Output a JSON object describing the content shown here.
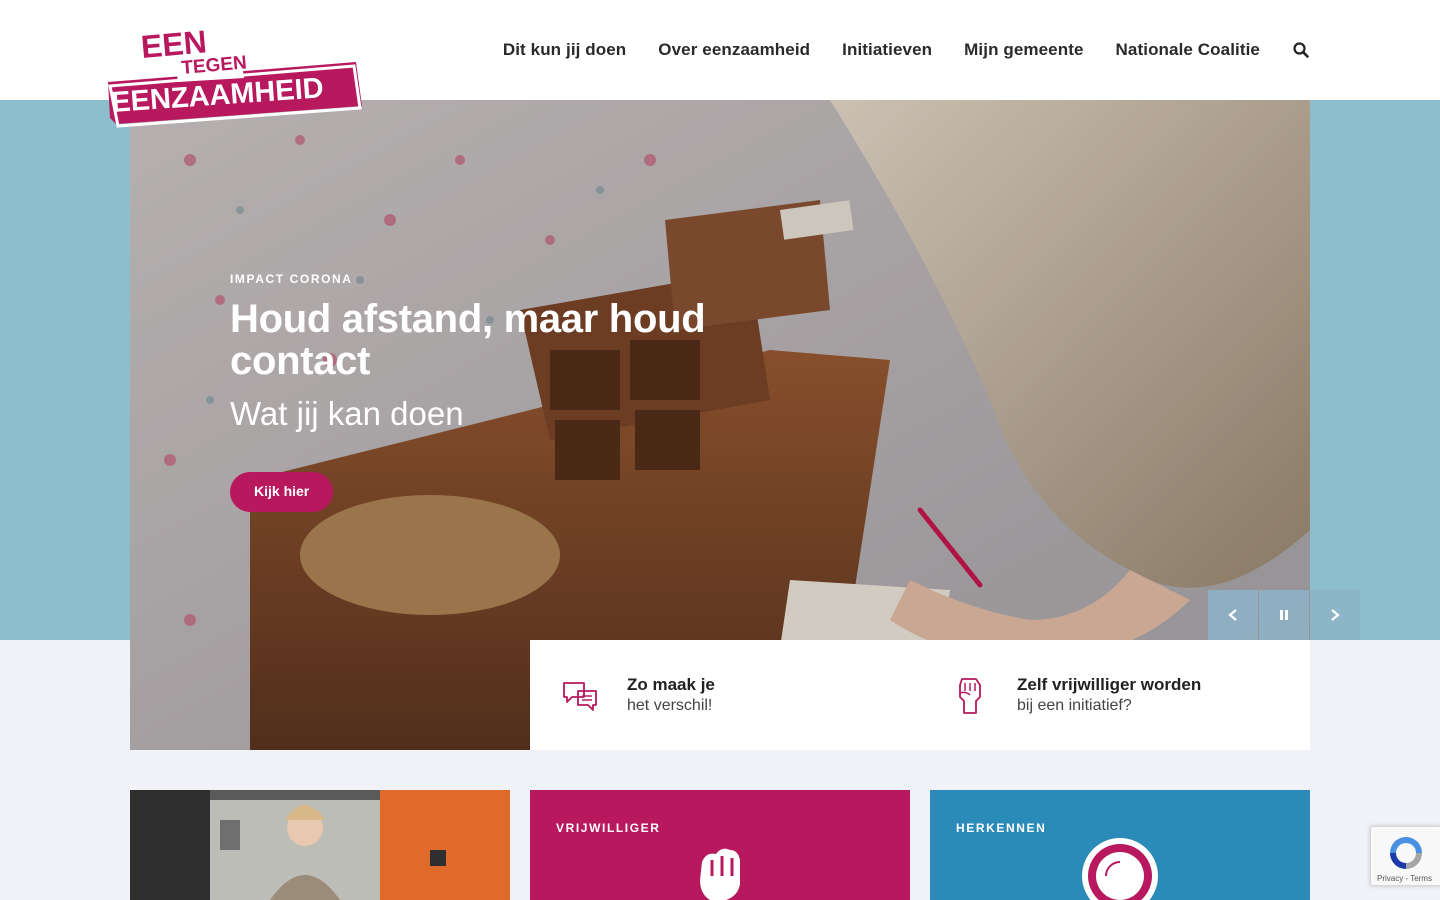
{
  "logo": {
    "line1": "EEN",
    "line2": "TEGEN",
    "line3": "EENZAAMHEID"
  },
  "nav": {
    "items": [
      "Dit kun jij doen",
      "Over eenzaamheid",
      "Initiatieven",
      "Mijn gemeente",
      "Nationale Coalitie"
    ],
    "search_icon": "search-icon"
  },
  "hero": {
    "eyebrow": "IMPACT CORONA",
    "title": "Houd afstand, maar houd contact",
    "subtitle": "Wat jij kan doen",
    "button": "Kijk hier",
    "controls": [
      "prev-icon",
      "pause-icon",
      "next-icon"
    ]
  },
  "features": [
    {
      "title": "Zo maak je",
      "subtitle": "het verschil!",
      "icon": "chat-bubbles-icon"
    },
    {
      "title": "Zelf vrijwilliger worden",
      "subtitle": "bij een initiatief?",
      "icon": "raised-fist-icon"
    }
  ],
  "cards": [
    {
      "label": "",
      "icon": "photo"
    },
    {
      "label": "VRIJWILLIGER",
      "icon": "fist-icon"
    },
    {
      "label": "HERKENNEN",
      "icon": "circle-icon"
    }
  ],
  "recaptcha": {
    "text": "Privacy - Terms"
  },
  "colors": {
    "brand_magenta": "#b7185e",
    "hero_band": "#8cbecb",
    "card_blue": "#2a8ab8",
    "page_bg": "#f1f1f8"
  }
}
